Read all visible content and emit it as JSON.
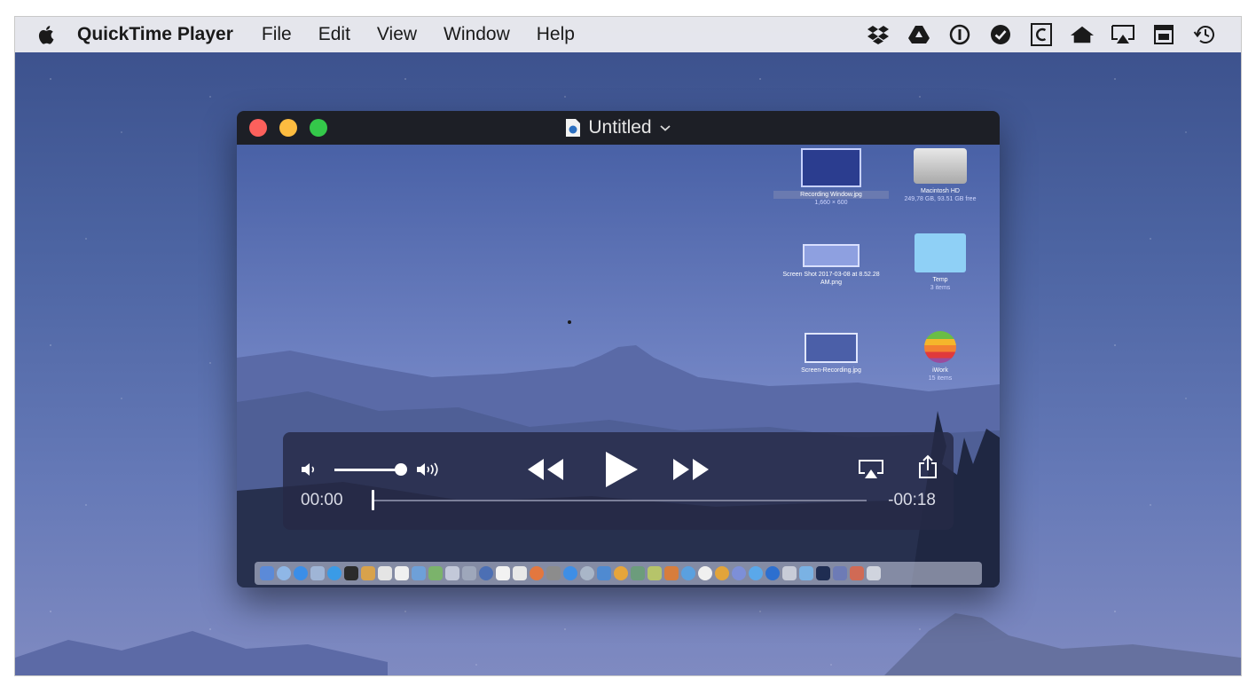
{
  "menubar": {
    "apple_icon": "apple-icon",
    "app_name": "QuickTime Player",
    "menus": [
      "File",
      "Edit",
      "View",
      "Window",
      "Help"
    ],
    "extras": [
      "dropbox-icon",
      "google-drive-icon",
      "1password-icon",
      "checkmark-circle-icon",
      "c-box-icon",
      "home-icon",
      "airplay-icon",
      "calendar-icon",
      "time-machine-icon"
    ]
  },
  "window": {
    "title": "Untitled",
    "title_chevron": "chevron-down-icon",
    "traffic_colors": {
      "close": "#fc605c",
      "minimize": "#fdbc40",
      "zoom": "#34c84a"
    }
  },
  "video_desktop": {
    "icons": [
      {
        "name": "Recording Window.jpg",
        "meta": "1,660 × 600"
      },
      {
        "name": "Macintosh HD",
        "meta": "249,78 GB, 93.51 GB free"
      },
      {
        "name": "Screen Shot 2017-03-08 at 8.52.28 AM.png",
        "meta": ""
      },
      {
        "name": "Temp",
        "meta": "3 items"
      },
      {
        "name": "Screen-Recording.jpg",
        "meta": ""
      },
      {
        "name": "iWork",
        "meta": "15 items"
      }
    ]
  },
  "player": {
    "time_elapsed": "00:00",
    "time_remaining": "-00:18",
    "volume_level": 0.9,
    "progress": 0.0
  },
  "colors": {
    "hud_bg": "#262a46",
    "titlebar_bg": "#1d1f26",
    "menubar_bg": "#ececf0"
  }
}
